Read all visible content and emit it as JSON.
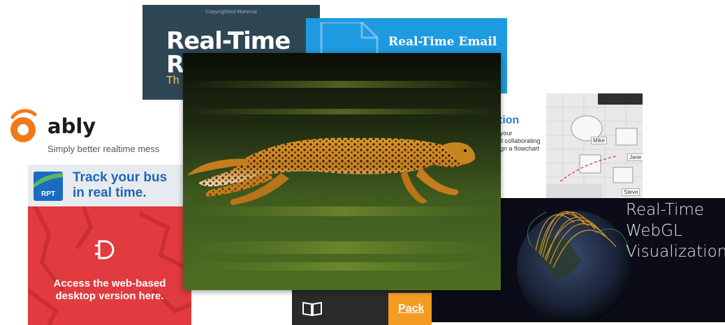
{
  "book_card": {
    "copyright": "Copyrighted Material",
    "title_line1": "Real-Time",
    "title_line2": "R",
    "subtitle": "Th"
  },
  "email_card": {
    "title": "Real-Time Email"
  },
  "ably_card": {
    "name": "ably",
    "tagline": "Simply better realtime mess"
  },
  "bus_card": {
    "logo_text": "RPT",
    "headline_line1": "Track your bus",
    "headline_line2": "in real time.",
    "body_line1": "Access the web-based",
    "body_line2": "desktop version here."
  },
  "flow_card": {
    "heading": "tion",
    "text_line1": "your",
    "text_line2": "ll collaborating",
    "text_line3": "gn a flowchart",
    "user_labels": [
      "Mike",
      "Jane",
      "Steve"
    ]
  },
  "webgl_card": {
    "line1": "Real-Time",
    "line2": "WebGL",
    "line3": "Visualizations"
  },
  "packt_card": {
    "label": "Pack"
  },
  "colors": {
    "ably_orange": "#f07a18",
    "bus_red": "#e23b3f",
    "bus_blue": "#1f66b8",
    "email_blue": "#1e9ae0",
    "book_slate": "#2f4654",
    "packt_orange": "#f49b24"
  }
}
